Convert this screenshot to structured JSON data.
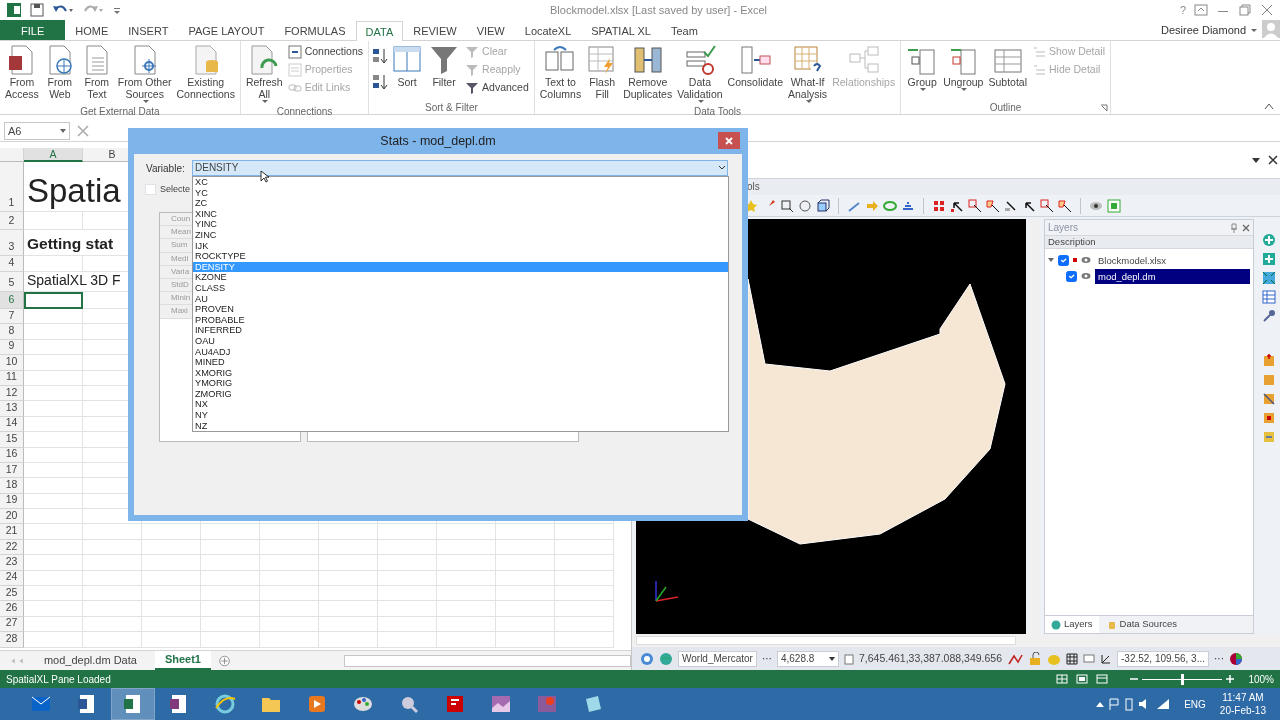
{
  "app": {
    "title": "Blockmodel.xlsx [Last saved by user] - Excel",
    "help": "?",
    "user": "Desiree Diamond"
  },
  "tabs": [
    {
      "label": "FILE",
      "kind": "file",
      "selected": false
    },
    {
      "label": "HOME",
      "kind": "tab",
      "selected": false
    },
    {
      "label": "INSERT",
      "kind": "tab",
      "selected": false
    },
    {
      "label": "PAGE LAYOUT",
      "kind": "tab",
      "selected": false
    },
    {
      "label": "FORMULAS",
      "kind": "tab",
      "selected": false
    },
    {
      "label": "DATA",
      "kind": "tab",
      "selected": true
    },
    {
      "label": "REVIEW",
      "kind": "tab",
      "selected": false
    },
    {
      "label": "VIEW",
      "kind": "tab",
      "selected": false
    },
    {
      "label": "LocateXL",
      "kind": "tab",
      "selected": false
    },
    {
      "label": "SPATIAL XL",
      "kind": "tab",
      "selected": false
    },
    {
      "label": "Team",
      "kind": "tab",
      "selected": false
    }
  ],
  "ribbon_groups": [
    {
      "label": "Get External Data",
      "items": [
        {
          "kind": "large",
          "label": "From\nAccess",
          "disabled": false,
          "dropdown": false
        },
        {
          "kind": "large",
          "label": "From\nWeb",
          "disabled": false,
          "dropdown": false
        },
        {
          "kind": "large",
          "label": "From\nText",
          "disabled": false,
          "dropdown": false
        },
        {
          "kind": "large",
          "label": "From Other\nSources",
          "disabled": false,
          "dropdown": true
        },
        {
          "kind": "large",
          "label": "Existing\nConnections",
          "disabled": false,
          "dropdown": false
        }
      ]
    },
    {
      "label": "Connections",
      "items": [
        {
          "kind": "large",
          "label": "Refresh\nAll",
          "disabled": false,
          "dropdown": true
        },
        {
          "kind": "stack",
          "items": [
            {
              "label": "Connections",
              "disabled": false
            },
            {
              "label": "Properties",
              "disabled": true
            },
            {
              "label": "Edit Links",
              "disabled": true
            }
          ]
        }
      ]
    },
    {
      "label": "Sort & Filter",
      "items": [
        {
          "kind": "sort-pair"
        },
        {
          "kind": "large",
          "label": "Sort",
          "disabled": false,
          "dropdown": false
        },
        {
          "kind": "large",
          "label": "Filter",
          "disabled": false,
          "dropdown": false
        },
        {
          "kind": "stack",
          "items": [
            {
              "label": "Clear",
              "disabled": true
            },
            {
              "label": "Reapply",
              "disabled": true
            },
            {
              "label": "Advanced",
              "disabled": false
            }
          ]
        }
      ]
    },
    {
      "label": "Data Tools",
      "items": [
        {
          "kind": "large",
          "label": "Text to\nColumns",
          "disabled": false,
          "dropdown": false
        },
        {
          "kind": "large",
          "label": "Flash\nFill",
          "disabled": false,
          "dropdown": false
        },
        {
          "kind": "large",
          "label": "Remove\nDuplicates",
          "disabled": false,
          "dropdown": false
        },
        {
          "kind": "large",
          "label": "Data\nValidation",
          "disabled": false,
          "dropdown": true
        },
        {
          "kind": "large",
          "label": "Consolidate",
          "disabled": false,
          "dropdown": false
        },
        {
          "kind": "large",
          "label": "What-If\nAnalysis",
          "disabled": false,
          "dropdown": true
        },
        {
          "kind": "large",
          "label": "Relationships",
          "disabled": true,
          "dropdown": false
        }
      ]
    },
    {
      "label": "Outline",
      "items": [
        {
          "kind": "large",
          "label": "Group",
          "disabled": false,
          "dropdown": true
        },
        {
          "kind": "large",
          "label": "Ungroup",
          "disabled": false,
          "dropdown": true
        },
        {
          "kind": "large",
          "label": "Subtotal",
          "disabled": false,
          "dropdown": false
        },
        {
          "kind": "stack",
          "items": [
            {
              "label": "Show Detail",
              "disabled": true
            },
            {
              "label": "Hide Detail",
              "disabled": true
            }
          ]
        }
      ]
    }
  ],
  "name_box": "A6",
  "sheet": {
    "columns": [
      {
        "label": "A",
        "selected": true
      },
      {
        "label": "B",
        "selected": false
      }
    ],
    "rows": [
      {
        "label": "1",
        "selected": false,
        "cell": "Spatia",
        "kind": "title"
      },
      {
        "label": "2",
        "selected": false
      },
      {
        "label": "3",
        "selected": false,
        "cell": "Getting stat",
        "kind": "heading"
      },
      {
        "label": "4",
        "selected": false
      },
      {
        "label": "5",
        "selected": false,
        "cell": "SpatialXL 3D F",
        "kind": "plain"
      },
      {
        "label": "6",
        "selected": true
      },
      {
        "label": "7",
        "selected": false
      },
      {
        "label": "8",
        "selected": false
      },
      {
        "label": "9",
        "selected": false
      },
      {
        "label": "10",
        "selected": false
      },
      {
        "label": "11",
        "selected": false
      },
      {
        "label": "12",
        "selected": false
      },
      {
        "label": "13",
        "selected": false
      },
      {
        "label": "14",
        "selected": false
      },
      {
        "label": "15",
        "selected": false
      },
      {
        "label": "16",
        "selected": false
      },
      {
        "label": "17",
        "selected": false
      },
      {
        "label": "18",
        "selected": false
      },
      {
        "label": "19",
        "selected": false
      },
      {
        "label": "20",
        "selected": false
      },
      {
        "label": "21",
        "selected": false
      },
      {
        "label": "22",
        "selected": false
      },
      {
        "label": "23",
        "selected": false
      },
      {
        "label": "24",
        "selected": false
      },
      {
        "label": "25",
        "selected": false
      },
      {
        "label": "26",
        "selected": false
      },
      {
        "label": "27",
        "selected": false
      },
      {
        "label": "28",
        "selected": false
      }
    ],
    "tabs": [
      {
        "label": "mod_depl.dm Data",
        "selected": false
      },
      {
        "label": "Sheet1",
        "selected": true
      }
    ]
  },
  "dialog": {
    "title": "Stats - mod_depl.dm",
    "variable_label": "Variable:",
    "variable_value": "DENSITY",
    "options": [
      {
        "label": "XC",
        "selected": false
      },
      {
        "label": "YC",
        "selected": false
      },
      {
        "label": "ZC",
        "selected": false
      },
      {
        "label": "XINC",
        "selected": false
      },
      {
        "label": "YINC",
        "selected": false
      },
      {
        "label": "ZINC",
        "selected": false
      },
      {
        "label": "IJK",
        "selected": false
      },
      {
        "label": "ROCKTYPE",
        "selected": false
      },
      {
        "label": "DENSITY",
        "selected": true
      },
      {
        "label": "KZONE",
        "selected": false
      },
      {
        "label": "CLASS",
        "selected": false
      },
      {
        "label": "AU",
        "selected": false
      },
      {
        "label": "PROVEN",
        "selected": false
      },
      {
        "label": "PROBABLE",
        "selected": false
      },
      {
        "label": "INFERRED",
        "selected": false
      },
      {
        "label": "OAU",
        "selected": false
      },
      {
        "label": "AU4ADJ",
        "selected": false
      },
      {
        "label": "MINED",
        "selected": false
      },
      {
        "label": "XMORIG",
        "selected": false
      },
      {
        "label": "YMORIG",
        "selected": false
      },
      {
        "label": "ZMORIG",
        "selected": false
      },
      {
        "label": "NX",
        "selected": false
      },
      {
        "label": "NY",
        "selected": false
      },
      {
        "label": "NZ",
        "selected": false
      }
    ],
    "selected_only": {
      "label": "Selecte",
      "checked": false
    },
    "stat_labels": [
      "Coun",
      "Mean",
      "Sum",
      "Medi",
      "Varia",
      "StdD",
      "Minin",
      "Maxi"
    ]
  },
  "pane": {
    "title": "ols",
    "layers": {
      "title": "Layers",
      "header": "Description",
      "tree": [
        {
          "label": "Blockmodel.xlsx",
          "checked": true,
          "expanded": true,
          "selected": false,
          "children": [
            {
              "label": "mod_depl.dm",
              "checked": true,
              "selected": true
            }
          ]
        }
      ]
    },
    "bottom_tabs": [
      {
        "label": "Layers",
        "selected": true
      },
      {
        "label": "Data Sources",
        "selected": false
      }
    ],
    "status": {
      "projection": "World_Mercator",
      "projection_button": "···",
      "scale": "4,628.8",
      "extent": "7,645.461,33,387.088,349.656",
      "coordinates": "-32.52, 109.56, 3...",
      "coordinates_button": "···"
    }
  },
  "status_bar": {
    "message": "SpatialXL Pane Loaded",
    "zoom": {
      "level": 0.5
    },
    "zoom_label": "100%"
  },
  "taskbar": {
    "apps": [
      {
        "selected": false
      },
      {
        "selected": false
      },
      {
        "selected": true
      },
      {
        "selected": false
      },
      {
        "selected": false
      },
      {
        "selected": false
      },
      {
        "selected": false
      },
      {
        "selected": false
      },
      {
        "selected": false
      },
      {
        "selected": false
      },
      {
        "selected": false
      },
      {
        "selected": false
      },
      {
        "selected": false
      }
    ],
    "language": "ENG",
    "time": "11:47 AM",
    "date": "20-Feb-13"
  }
}
